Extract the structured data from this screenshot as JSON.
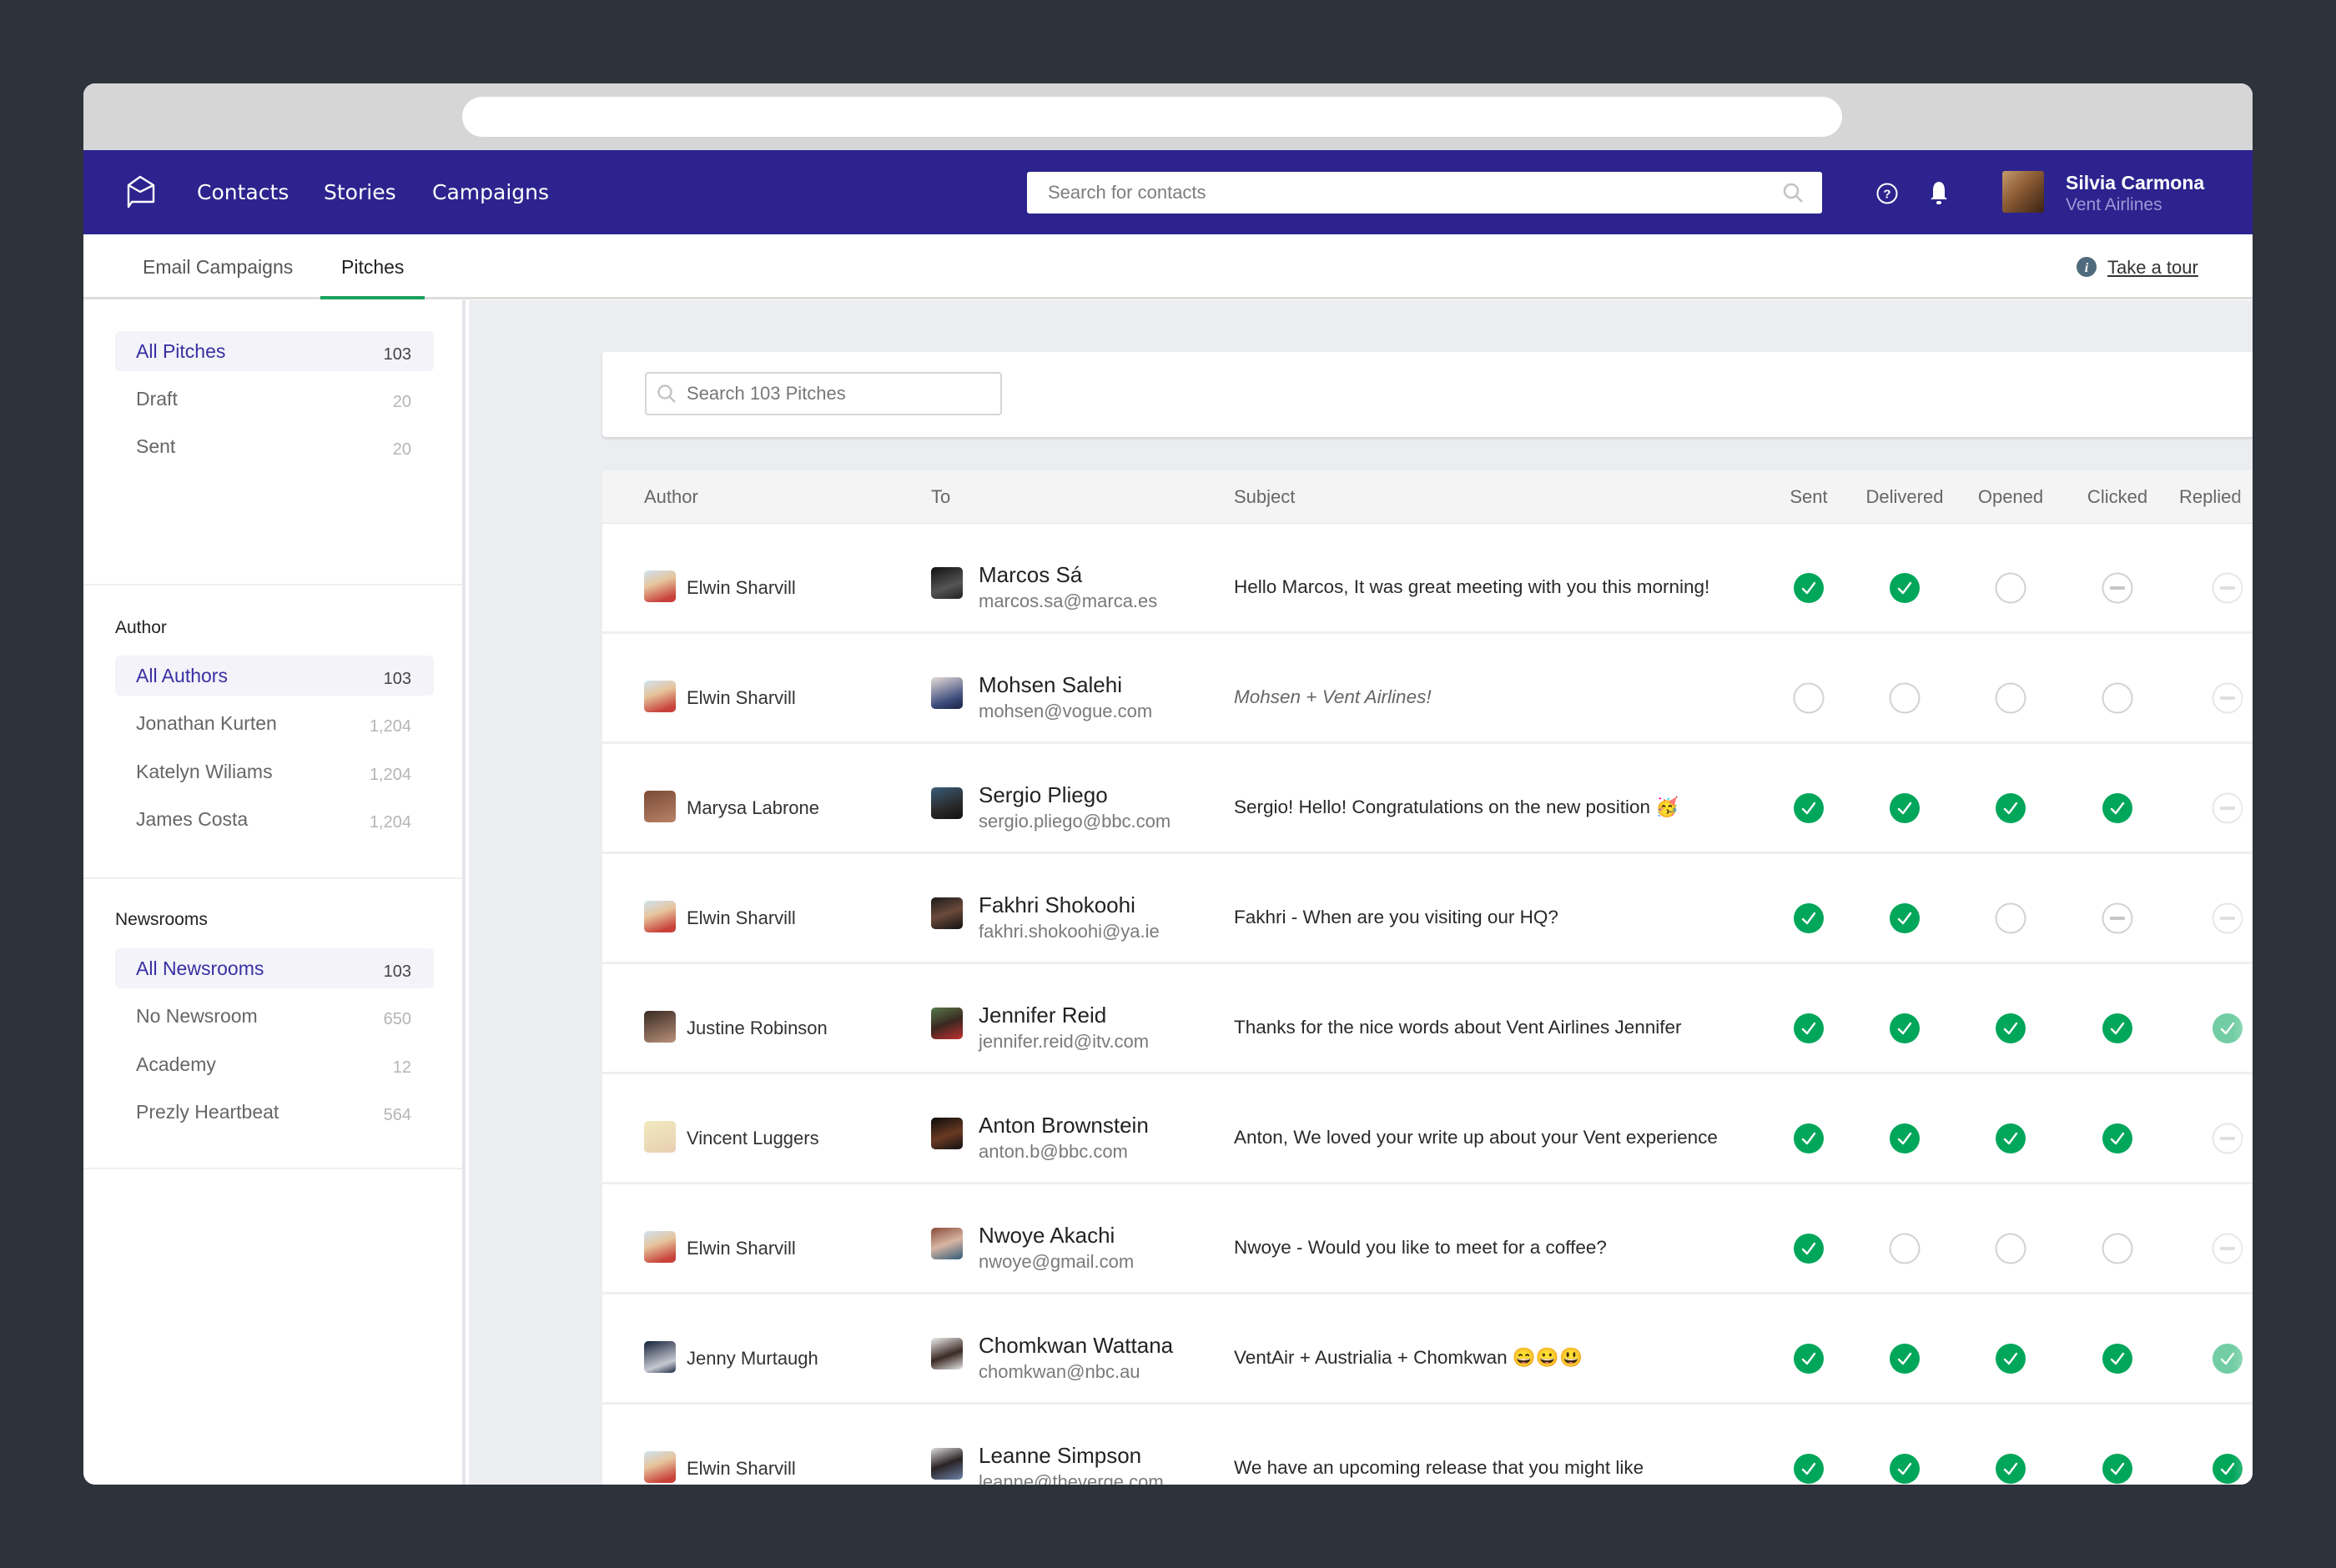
{
  "app": {
    "nav": [
      "Contacts",
      "Stories",
      "Campaigns"
    ],
    "search_placeholder": "Search for contacts",
    "user": {
      "name": "Silvia Carmona",
      "org": "Vent Airlines"
    },
    "brand_color": "#2c238e",
    "success_color": "#00a65a"
  },
  "subnav": {
    "tabs": [
      {
        "label": "Email Campaigns",
        "active": false
      },
      {
        "label": "Pitches",
        "active": true
      }
    ],
    "tour_link": "Take a tour"
  },
  "sidebar": {
    "status_filters": [
      {
        "label": "All Pitches",
        "count": "103",
        "active": true
      },
      {
        "label": "Draft",
        "count": "20",
        "active": false
      },
      {
        "label": "Sent",
        "count": "20",
        "active": false
      }
    ],
    "author_heading": "Author",
    "author_filters": [
      {
        "label": "All Authors",
        "count": "103",
        "active": true
      },
      {
        "label": "Jonathan Kurten",
        "count": "1,204",
        "active": false
      },
      {
        "label": "Katelyn Wiliams",
        "count": "1,204",
        "active": false
      },
      {
        "label": "James Costa",
        "count": "1,204",
        "active": false
      }
    ],
    "newsroom_heading": "Newsrooms",
    "newsroom_filters": [
      {
        "label": "All Newsrooms",
        "count": "103",
        "active": true
      },
      {
        "label": "No Newsroom",
        "count": "650",
        "active": false
      },
      {
        "label": "Academy",
        "count": "12",
        "active": false
      },
      {
        "label": "Prezly Heartbeat",
        "count": "564",
        "active": false
      }
    ]
  },
  "main": {
    "search_placeholder": "Search 103 Pitches",
    "columns": {
      "author": "Author",
      "to": "To",
      "subject": "Subject",
      "sent": "Sent",
      "delivered": "Delivered",
      "opened": "Opened",
      "clicked": "Clicked",
      "replied": "Replied"
    },
    "rows": [
      {
        "author": "Elwin Sharvill",
        "to_name": "Marcos Sá",
        "to_email": "marcos.sa@marca.es",
        "subject": "Hello Marcos, It was great meeting with you this morning!",
        "draft": false,
        "status": {
          "sent": "done",
          "delivered": "done",
          "opened": "pending",
          "clicked": "na",
          "replied": "na"
        }
      },
      {
        "author": "Elwin Sharvill",
        "to_name": "Mohsen Salehi",
        "to_email": "mohsen@vogue.com",
        "subject": "Mohsen + Vent Airlines!",
        "draft": true,
        "status": {
          "sent": "pending",
          "delivered": "pending",
          "opened": "pending",
          "clicked": "pending",
          "replied": "na"
        }
      },
      {
        "author": "Marysa Labrone",
        "to_name": "Sergio Pliego",
        "to_email": "sergio.pliego@bbc.com",
        "subject": "Sergio! Hello! Congratulations on the new position 🥳",
        "draft": false,
        "status": {
          "sent": "done",
          "delivered": "done",
          "opened": "done",
          "clicked": "done",
          "replied": "na"
        }
      },
      {
        "author": "Elwin Sharvill",
        "to_name": "Fakhri Shokoohi",
        "to_email": "fakhri.shokoohi@ya.ie",
        "subject": "Fakhri - When are you visiting our HQ?",
        "draft": false,
        "status": {
          "sent": "done",
          "delivered": "done",
          "opened": "pending",
          "clicked": "na",
          "replied": "na"
        }
      },
      {
        "author": "Justine Robinson",
        "to_name": "Jennifer Reid",
        "to_email": "jennifer.reid@itv.com",
        "subject": "Thanks for the nice words about Vent Airlines Jennifer",
        "draft": false,
        "status": {
          "sent": "done",
          "delivered": "done",
          "opened": "done",
          "clicked": "done",
          "replied": "done"
        }
      },
      {
        "author": "Vincent Luggers",
        "to_name": "Anton Brownstein",
        "to_email": "anton.b@bbc.com",
        "subject": "Anton, We loved your write up about your Vent experience",
        "draft": false,
        "status": {
          "sent": "done",
          "delivered": "done",
          "opened": "done",
          "clicked": "done",
          "replied": "na"
        }
      },
      {
        "author": "Elwin Sharvill",
        "to_name": "Nwoye Akachi",
        "to_email": "nwoye@gmail.com",
        "subject": "Nwoye - Would you like to meet for a coffee?",
        "draft": false,
        "status": {
          "sent": "done",
          "delivered": "pending",
          "opened": "pending",
          "clicked": "pending",
          "replied": "na"
        }
      },
      {
        "author": "Jenny Murtaugh",
        "to_name": "Chomkwan Wattana",
        "to_email": "chomkwan@nbc.au",
        "subject": "VentAir + Austrialia + Chomkwan 😄😀😃",
        "draft": false,
        "status": {
          "sent": "done",
          "delivered": "done",
          "opened": "done",
          "clicked": "done",
          "replied": "done"
        }
      },
      {
        "author": "Elwin Sharvill",
        "to_name": "Leanne Simpson",
        "to_email": "leanne@theverge.com",
        "subject": "We have an upcoming release that you might like",
        "draft": false,
        "status": {
          "sent": "done",
          "delivered": "done",
          "opened": "done",
          "clicked": "done",
          "replied": "done"
        }
      }
    ]
  }
}
